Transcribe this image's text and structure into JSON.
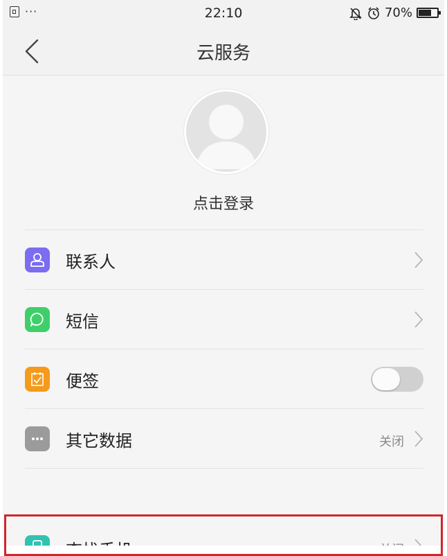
{
  "status_bar": {
    "time": "22:10",
    "battery_percent": "70%",
    "battery_level": 0.7,
    "more_dots": "···",
    "icons": [
      "sim-icon",
      "bell-muted-icon",
      "alarm-icon",
      "battery-icon"
    ]
  },
  "header": {
    "title": "云服务",
    "back_icon": "back-chevron-icon"
  },
  "profile": {
    "login_label": "点击登录",
    "avatar_icon": "default-avatar-icon"
  },
  "items": [
    {
      "label": "联系人",
      "icon": "contacts-icon",
      "icon_color": "#7b6cf0",
      "control": "chevron"
    },
    {
      "label": "短信",
      "icon": "message-icon",
      "icon_color": "#3fcf6a",
      "control": "chevron"
    },
    {
      "label": "便签",
      "icon": "notes-icon",
      "icon_color": "#f59a1b",
      "control": "toggle",
      "toggle_on": false
    },
    {
      "label": "其它数据",
      "icon": "more-data-icon",
      "icon_color": "#9b9b9b",
      "control": "status-chevron",
      "status": "关闭"
    }
  ],
  "find_phone": {
    "label": "查找手机",
    "status": "关闭",
    "icon": "find-phone-icon",
    "icon_color": "#2fc3b0",
    "highlighted": true,
    "highlight_color": "#d0262a"
  }
}
